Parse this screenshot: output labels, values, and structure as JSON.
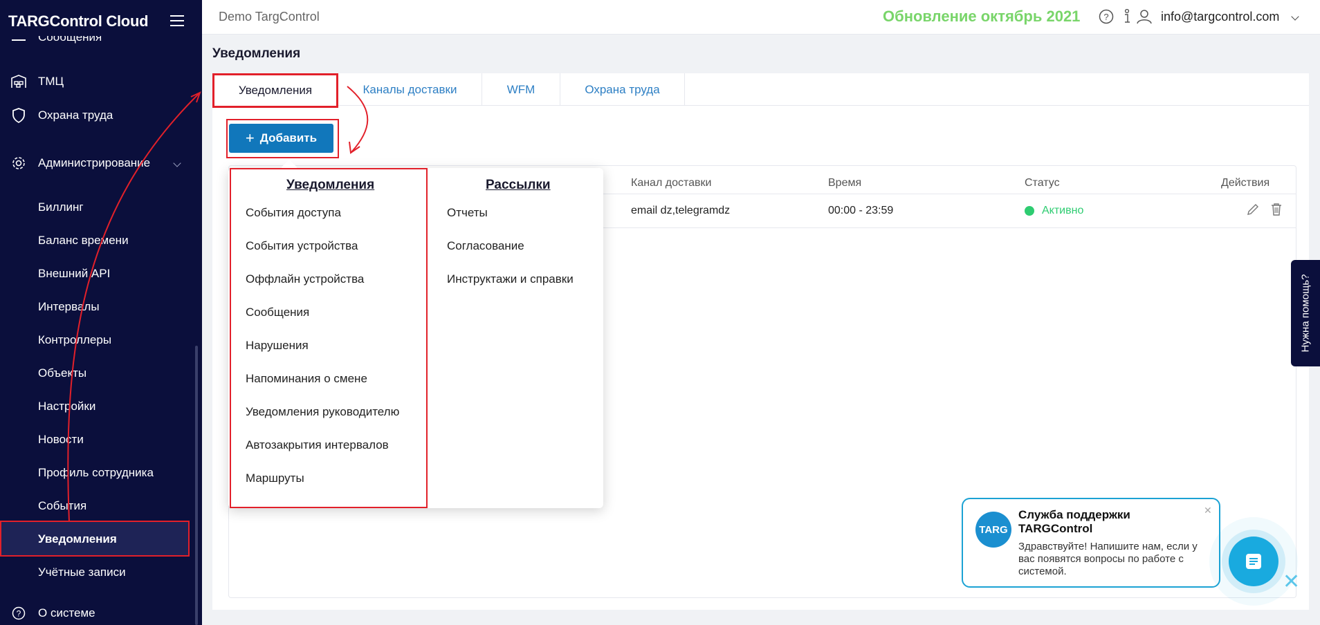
{
  "app": {
    "brand": "TARGControl Cloud",
    "demo_label": "Demo TargControl",
    "update_banner": "Обновление октябрь 2021",
    "user_email": "info@targcontrol.com"
  },
  "sidebar": {
    "partial_top": "Сообщения",
    "items": [
      {
        "label": "ТМЦ",
        "icon": "warehouse-icon"
      },
      {
        "label": "Охрана труда",
        "icon": "shield-icon"
      },
      {
        "label": "Администрирование",
        "icon": "gear-icon"
      }
    ],
    "sub_items": [
      "Биллинг",
      "Баланс времени",
      "Внешний API",
      "Интервалы",
      "Контроллеры",
      "Объекты",
      "Настройки",
      "Новости",
      "Профиль сотрудника",
      "События",
      "Уведомления",
      "Учётные записи"
    ],
    "bottom": {
      "label": "О системе",
      "icon": "help-icon"
    }
  },
  "page": {
    "title": "Уведомления"
  },
  "tabs": [
    "Уведомления",
    "Каналы доставки",
    "WFM",
    "Охрана труда"
  ],
  "toolbar": {
    "add_label": "Добавить"
  },
  "table": {
    "columns": [
      "Канал доставки",
      "Время",
      "Статус",
      "Действия"
    ],
    "rows": [
      {
        "channel": "email dz,telegramdz",
        "time": "00:00 - 23:59",
        "status": "Активно"
      }
    ]
  },
  "popup": {
    "col1_title": "Уведомления",
    "col1_items": [
      "События доступа",
      "События устройства",
      "Оффлайн устройства",
      "Сообщения",
      "Нарушения",
      "Напоминания о смене",
      "Уведомления руководителю",
      "Автозакрытия интервалов",
      "Маршруты"
    ],
    "col2_title": "Рассылки",
    "col2_items": [
      "Отчеты",
      "Согласование",
      "Инструктажи и справки"
    ]
  },
  "help_tab": "Нужна помощь?",
  "support": {
    "logo": "TARG",
    "title": "Служба поддержки TARGControl",
    "text": "Здравствуйте! Напишите нам, если у вас появятся вопросы по работе с системой."
  },
  "colors": {
    "sidebar": "#0b0f3c",
    "accent": "#1177bb",
    "highlight": "#e2202a",
    "status_active": "#2ecc71",
    "update_banner": "#79d56a"
  }
}
